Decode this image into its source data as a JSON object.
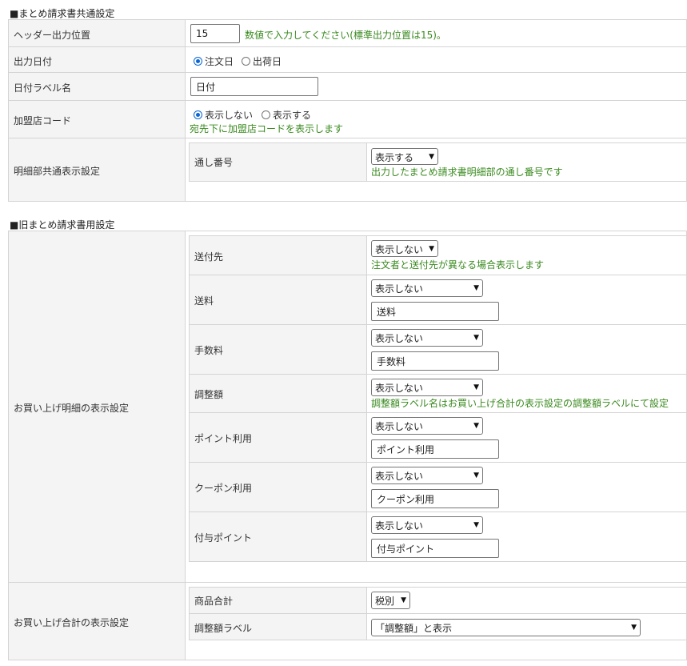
{
  "common": {
    "title": "■まとめ請求書共通設定",
    "header_position": {
      "label": "ヘッダー出力位置",
      "value": "15",
      "note": "数値で入力してください(標準出力位置は15)。"
    },
    "output_date": {
      "label": "出力日付",
      "options": [
        "注文日",
        "出荷日"
      ],
      "selected": "注文日"
    },
    "date_label": {
      "label": "日付ラベル名",
      "value": "日付"
    },
    "member_code": {
      "label": "加盟店コード",
      "options": [
        "表示しない",
        "表示する"
      ],
      "selected": "表示しない",
      "note": "宛先下に加盟店コードを表示します"
    },
    "detail_common": {
      "label": "明細部共通表示設定",
      "serial": {
        "label": "通し番号",
        "selected": "表示する",
        "note": "出力したまとめ請求書明細部の通し番号です"
      }
    }
  },
  "legacy": {
    "title": "■旧まとめ請求書用設定",
    "purchase_detail": {
      "label": "お買い上げ明細の表示設定",
      "rows": {
        "shipto": {
          "label": "送付先",
          "selected": "表示しない",
          "note": "注文者と送付先が異なる場合表示します"
        },
        "shipping": {
          "label": "送料",
          "selected": "表示しない",
          "input": "送料"
        },
        "fee": {
          "label": "手数料",
          "selected": "表示しない",
          "input": "手数料"
        },
        "adjust": {
          "label": "調整額",
          "selected": "表示しない",
          "note": "調整額ラベル名はお買い上げ合計の表示設定の調整額ラベルにて設定"
        },
        "point_use": {
          "label": "ポイント利用",
          "selected": "表示しない",
          "input": "ポイント利用"
        },
        "coupon_use": {
          "label": "クーポン利用",
          "selected": "表示しない",
          "input": "クーポン利用"
        },
        "grant_point": {
          "label": "付与ポイント",
          "selected": "表示しない",
          "input": "付与ポイント"
        }
      }
    },
    "purchase_total": {
      "label": "お買い上げ合計の表示設定",
      "product_total": {
        "label": "商品合計",
        "selected": "税別"
      },
      "adjust_label": {
        "label": "調整額ラベル",
        "selected": "「調整額」と表示"
      }
    }
  }
}
